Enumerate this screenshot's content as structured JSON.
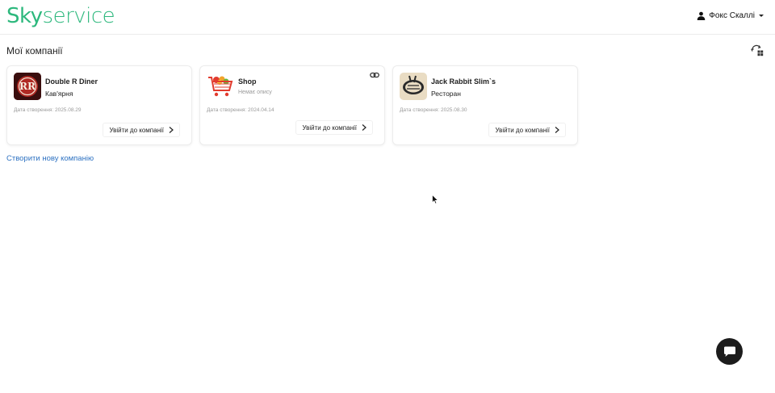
{
  "header": {
    "logo_sky": "Sky",
    "logo_service": "service",
    "user_name": "Фокс Скаллі"
  },
  "main": {
    "title": "Мої компанії",
    "companies": [
      {
        "name": "Double R Diner",
        "description": "Кав'ярня",
        "created": "Дата створення: 2025.08.29",
        "enter_label": "Увійти до компанії",
        "logo_text": "RR"
      },
      {
        "name": "Shop",
        "description": "Немає опису",
        "created": "Дата створення: 2024.04.14",
        "enter_label": "Увійти до компанії"
      },
      {
        "name": "Jack Rabbit Slim`s",
        "description": "Ресторан",
        "created": "Дата створення: 2025.08.30",
        "enter_label": "Увійти до компанії"
      }
    ],
    "create_label": "Створити нову компанію"
  },
  "icons": {
    "user": "user-icon",
    "switch": "switch-view-icon",
    "link": "link-icon",
    "chevron": "chevron-right-icon",
    "chat": "chat-icon"
  },
  "colors": {
    "brand_green": "#2db87d",
    "link_blue": "#2e72c2",
    "chat_bg": "#1c1c1c"
  }
}
